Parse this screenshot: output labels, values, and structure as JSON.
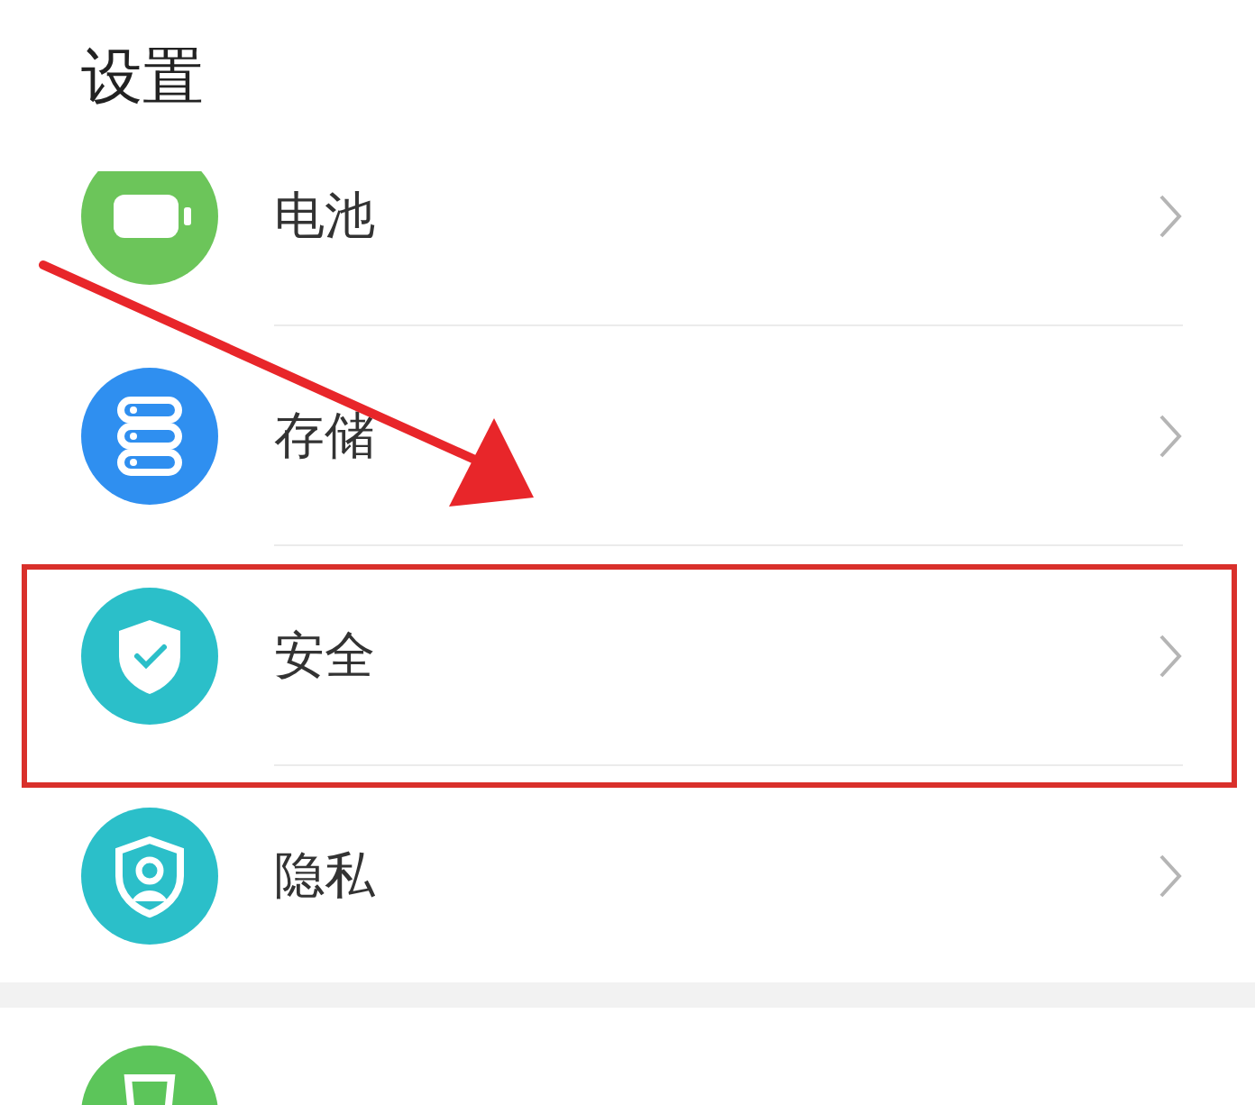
{
  "title": "设置",
  "sections": [
    {
      "items": [
        {
          "kind": "battery",
          "label": "电池",
          "color": "#6cc55a",
          "highlighted": false
        },
        {
          "kind": "storage",
          "label": "存储",
          "color": "#2f8ff0",
          "highlighted": false
        },
        {
          "kind": "security",
          "label": "安全",
          "color": "#2bbfc9",
          "highlighted": true
        },
        {
          "kind": "privacy",
          "label": "隐私",
          "color": "#2bbfc9",
          "highlighted": false
        }
      ]
    },
    {
      "items": [
        {
          "kind": "health",
          "color": "#5cc55a",
          "highlighted": false
        }
      ]
    }
  ],
  "annotation_arrow": true
}
